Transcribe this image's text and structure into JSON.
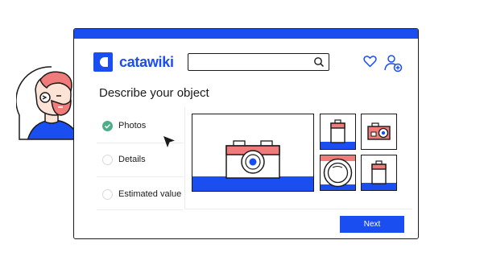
{
  "app": {
    "logo_text": "catawiki"
  },
  "search": {
    "value": "",
    "placeholder": ""
  },
  "page": {
    "title": "Describe your object"
  },
  "steps": [
    {
      "label": "Photos",
      "status": "complete"
    },
    {
      "label": "Details",
      "status": "pending"
    },
    {
      "label": "Estimated value",
      "status": "pending"
    }
  ],
  "actions": {
    "next_label": "Next"
  },
  "icons": {
    "search": "search-icon",
    "favorites": "heart-icon",
    "account": "add-user-icon",
    "step_done": "check-circle-icon",
    "step_pending": "empty-circle-icon",
    "pointer": "cursor-icon"
  },
  "colors": {
    "brand_blue": "#1a4ef0",
    "accent_pink": "#f07b7b",
    "success_green": "#4caf8a",
    "outline": "#1b1b1b"
  }
}
